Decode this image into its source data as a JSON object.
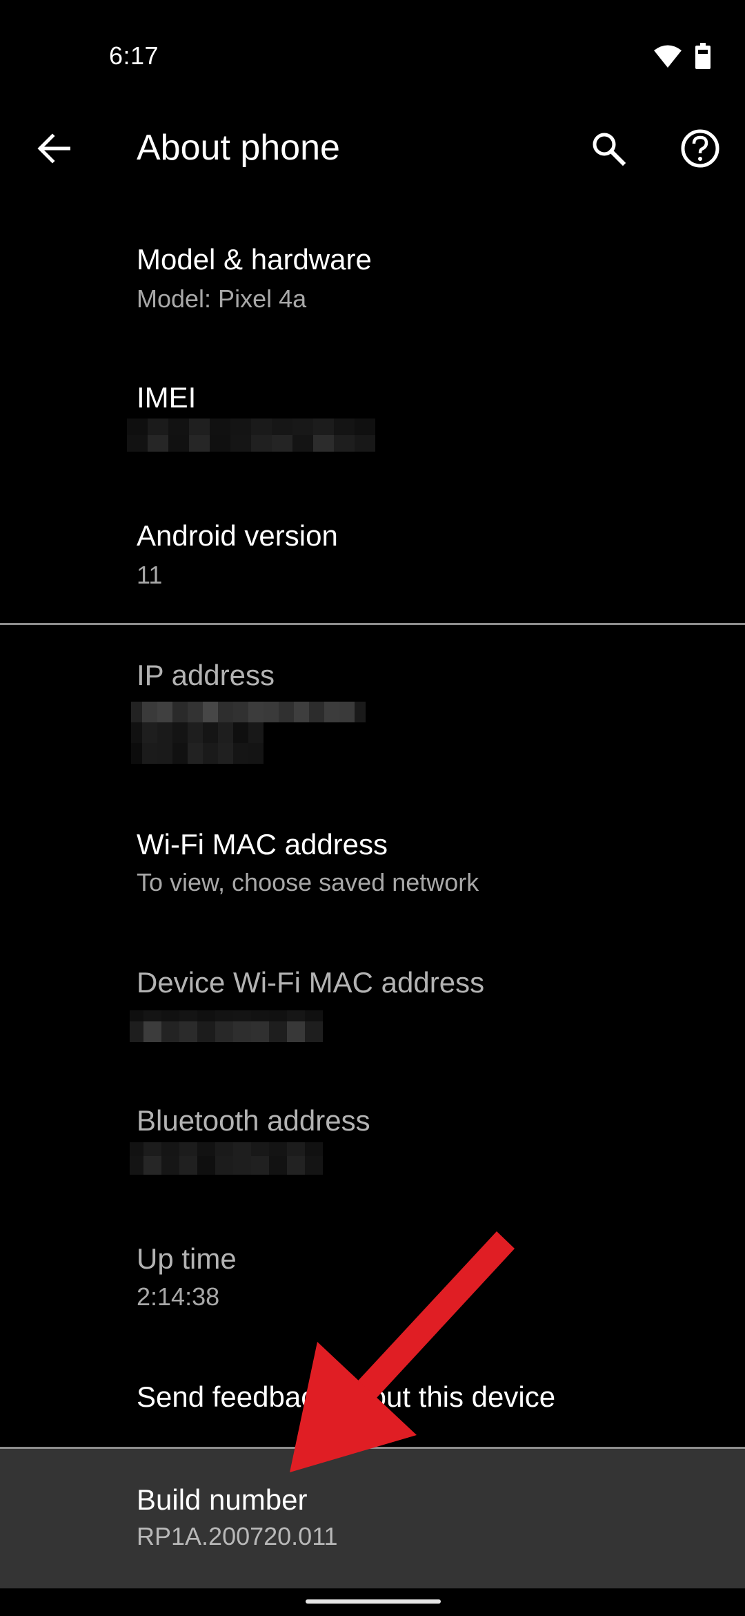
{
  "status_bar": {
    "time": "6:17",
    "icons": [
      "wifi-icon",
      "battery-icon"
    ]
  },
  "app_bar": {
    "title": "About phone",
    "back_icon": "arrow-back-icon",
    "actions": [
      {
        "name": "search",
        "icon": "search-icon"
      },
      {
        "name": "help",
        "icon": "help-circle-icon"
      }
    ]
  },
  "items": [
    {
      "title": "Model & hardware",
      "summary": "Model: Pixel 4a",
      "enabled": true
    },
    {
      "title": "IMEI",
      "summary": "[redacted]",
      "enabled": true
    },
    {
      "title": "Android version",
      "summary": "11",
      "enabled": true
    },
    {
      "title": "IP address",
      "summary": "[redacted]",
      "enabled": false
    },
    {
      "title": "Wi-Fi MAC address",
      "summary": "To view, choose saved network",
      "enabled": true
    },
    {
      "title": "Device Wi-Fi MAC address",
      "summary": "[redacted]",
      "enabled": false
    },
    {
      "title": "Bluetooth address",
      "summary": "[redacted]",
      "enabled": false
    },
    {
      "title": "Up time",
      "summary": "2:14:38",
      "enabled": false
    },
    {
      "title": "Send feedback about this device",
      "summary": "",
      "enabled": true
    },
    {
      "title": "Build number",
      "summary": "RP1A.200720.011",
      "enabled": true,
      "highlighted": true
    }
  ],
  "annotation": {
    "type": "arrow",
    "color": "#e01e24",
    "points_to": "Build number"
  },
  "colors": {
    "background": "#000000",
    "highlight_row": "#343434",
    "divider": "#8d8d8d",
    "primary_text": "#ffffff",
    "secondary_text": "#a8a8a8"
  }
}
